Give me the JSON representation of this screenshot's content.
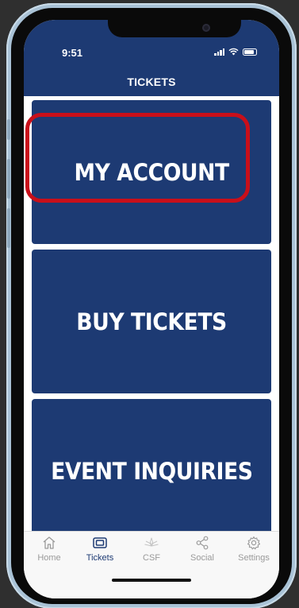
{
  "status_bar": {
    "time": "9:51"
  },
  "header": {
    "title": "TICKETS"
  },
  "tiles": [
    {
      "label": "MY ACCOUNT"
    },
    {
      "label": "BUY TICKETS"
    },
    {
      "label": "EVENT INQUIRIES"
    }
  ],
  "tabbar": {
    "items": [
      {
        "label": "Home",
        "icon": "home-icon"
      },
      {
        "label": "Tickets",
        "icon": "ticket-icon"
      },
      {
        "label": "CSF",
        "icon": "csf-logo-icon"
      },
      {
        "label": "Social",
        "icon": "share-icon"
      },
      {
        "label": "Settings",
        "icon": "gear-icon"
      }
    ],
    "active": "Tickets"
  },
  "colors": {
    "brand_navy": "#1d3a73",
    "highlight_red": "#c90f1a",
    "tab_inactive": "#9a9a9a"
  }
}
